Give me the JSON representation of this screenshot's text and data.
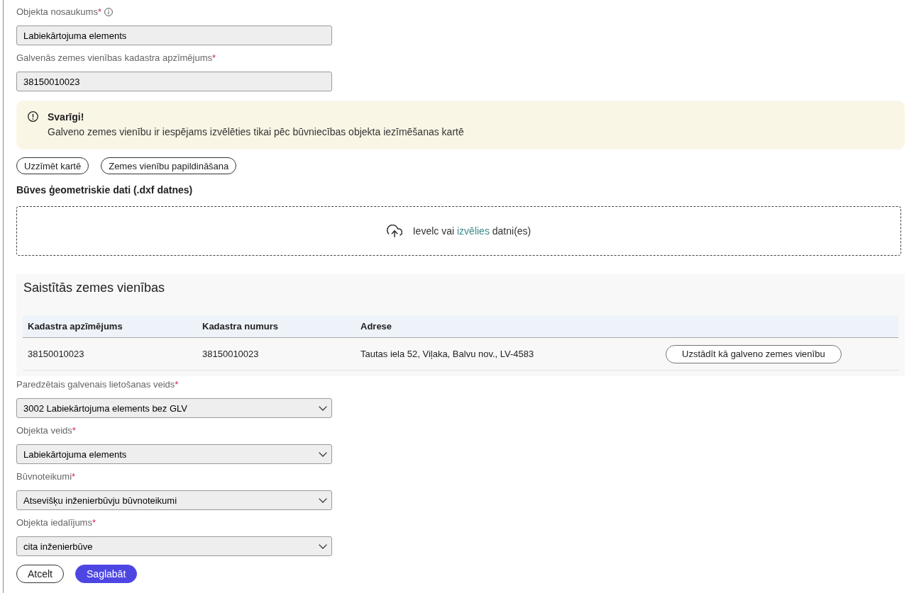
{
  "fields": [
    {
      "kind": "text",
      "label": "Objekta nosaukums",
      "required_mark": "*",
      "info": true,
      "value": "Labiekārtojuma elements"
    },
    {
      "kind": "text",
      "label": "Galvenās zemes vienības kadastra apzīmējums",
      "required_mark": "*",
      "info": false,
      "value": "38150010023"
    }
  ],
  "notice": {
    "title": "Svarīgi!",
    "text": "Galveno zemes vienību ir iespējams izvēlēties tikai pēc būvniecības objekta iezīmēšanas kartē"
  },
  "map_buttons": [
    "Uzzīmēt kartē",
    "Zemes vienību papildināšana"
  ],
  "geometry": {
    "heading": "Būves ģeometriskie dati (.dxf datnes)",
    "upload": {
      "before": "Ievelc vai",
      "link": "izvēlies",
      "after": "datni(es)"
    }
  },
  "linked_units": {
    "title": "Saistītās zemes vienības",
    "table": {
      "columns": [
        "Kadastra apzīmējums",
        "Kadastra numurs",
        "Adrese"
      ],
      "rows": [
        {
          "cells": [
            "38150010023",
            "38150010023",
            "Tautas iela 52, Viļaka, Balvu nov., LV-4583"
          ],
          "action": "Uzstādīt kā galveno zemes vienību"
        }
      ]
    }
  },
  "classification": [
    {
      "kind": "select",
      "label": "Paredzētais galvenais lietošanas veids",
      "required_mark": "*",
      "info": false,
      "value": "3002 Labiekārtojuma elements bez GLV"
    },
    {
      "kind": "select",
      "label": "Objekta veids",
      "required_mark": "*",
      "info": false,
      "value": "Labiekārtojuma elements"
    },
    {
      "kind": "select",
      "label": "Būvnoteikumi",
      "required_mark": "*",
      "info": false,
      "value": "Atsevišķu inženierbūvju būvnoteikumi"
    },
    {
      "kind": "select",
      "label": "Objekta iedalījums",
      "required_mark": "*",
      "info": false,
      "value": "cita inženierbūve"
    }
  ],
  "actions": [
    {
      "kind": "secondary",
      "label": "Atcelt"
    },
    {
      "kind": "primary",
      "label": "Saglabāt"
    }
  ]
}
